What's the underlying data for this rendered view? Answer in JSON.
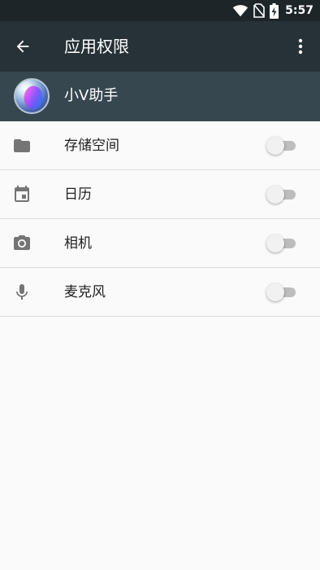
{
  "status_bar": {
    "time": "5:57",
    "icons": [
      "wifi-icon",
      "no-sim-icon",
      "battery-charging-icon"
    ]
  },
  "toolbar": {
    "title": "应用权限",
    "back_icon": "arrow-back-icon",
    "more_icon": "more-vertical-icon"
  },
  "app": {
    "name": "小V助手",
    "icon": "app-logo-icon"
  },
  "permissions": [
    {
      "label": "存储空间",
      "icon": "folder-icon",
      "enabled": false
    },
    {
      "label": "日历",
      "icon": "calendar-icon",
      "enabled": false
    },
    {
      "label": "相机",
      "icon": "camera-icon",
      "enabled": false
    },
    {
      "label": "麦克风",
      "icon": "microphone-icon",
      "enabled": false
    }
  ],
  "colors": {
    "status_bar": "#1d2529",
    "toolbar": "#263238",
    "app_header": "#37474f",
    "background": "#fafafa",
    "icon_gray": "#757575",
    "switch_track_off": "#bdbdbd",
    "switch_thumb_off": "#f1f1f1"
  }
}
